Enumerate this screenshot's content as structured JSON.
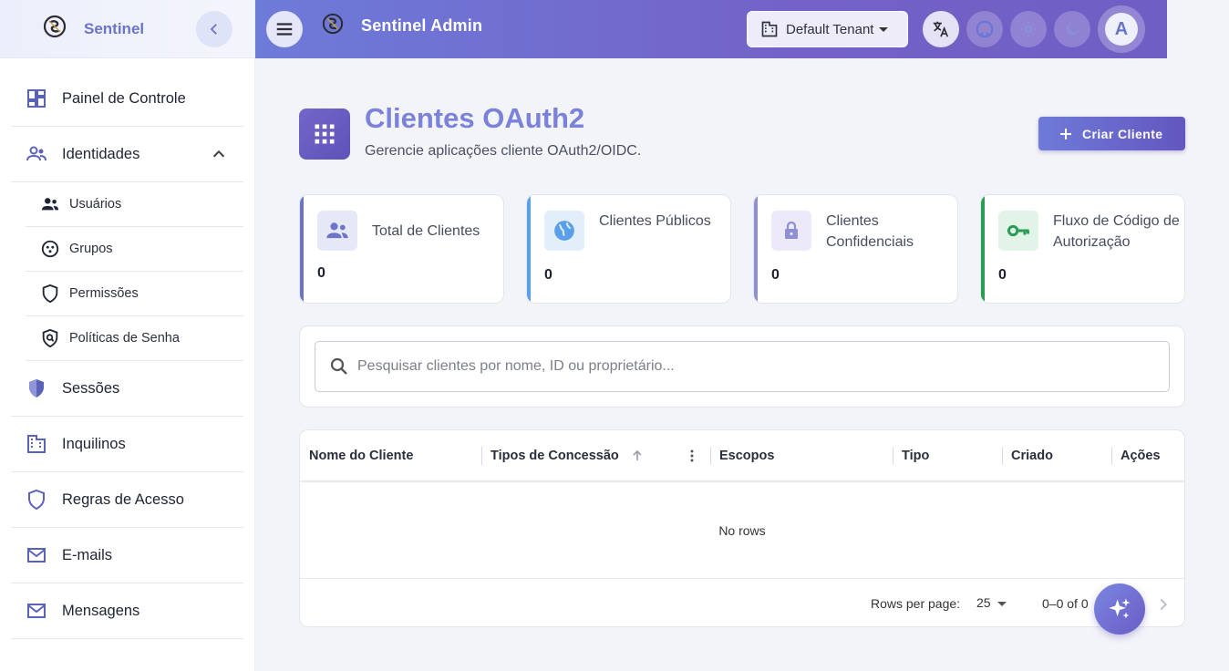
{
  "sidebar": {
    "brand": "Sentinel",
    "items": [
      {
        "label": "Painel de Controle"
      },
      {
        "label": "Identidades"
      },
      {
        "label": "Usuários"
      },
      {
        "label": "Grupos"
      },
      {
        "label": "Permissões"
      },
      {
        "label": "Políticas de Senha"
      },
      {
        "label": "Sessões"
      },
      {
        "label": "Inquilinos"
      },
      {
        "label": "Regras de Acesso"
      },
      {
        "label": "E-mails"
      },
      {
        "label": "Mensagens"
      }
    ]
  },
  "topbar": {
    "title": "Sentinel Admin",
    "tenant": "Default Tenant",
    "avatar_letter": "A"
  },
  "page": {
    "title": "Clientes OAuth2",
    "subtitle": "Gerencie aplicações cliente OAuth2/OIDC.",
    "create_label": "Criar Cliente"
  },
  "stats": [
    {
      "label": "Total de Clientes",
      "value": "0",
      "color": "#6b74c9"
    },
    {
      "label": "Clientes Públicos",
      "value": "0",
      "color": "#5aa0e8"
    },
    {
      "label": "Clientes Confidenciais",
      "value": "0",
      "color": "#8f8fd6"
    },
    {
      "label": "Fluxo de Código de Autorização",
      "value": "0",
      "color": "#2a9d55"
    }
  ],
  "search": {
    "placeholder": "Pesquisar clientes por nome, ID ou proprietário..."
  },
  "table": {
    "columns": [
      "Nome do Cliente",
      "Tipos de Concessão",
      "Escopos",
      "Tipo",
      "Criado",
      "Ações"
    ],
    "empty_text": "No rows",
    "rows_per_page_label": "Rows per page:",
    "rows_per_page": "25",
    "range": "0–0 of 0"
  }
}
